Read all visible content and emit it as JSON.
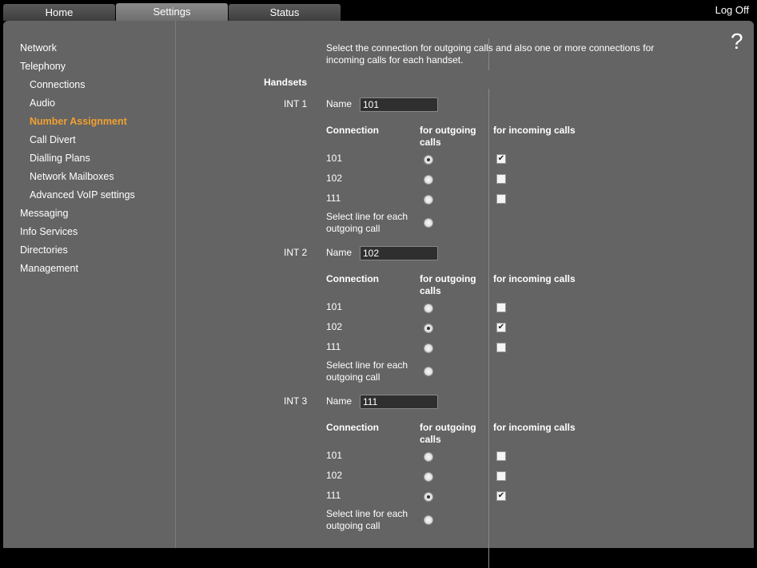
{
  "tabs": [
    {
      "label": "Home",
      "active": false
    },
    {
      "label": "Settings",
      "active": true
    },
    {
      "label": "Status",
      "active": false
    }
  ],
  "logoff": "Log Off",
  "help": "?",
  "nav": [
    {
      "label": "Network",
      "level": 0
    },
    {
      "label": "Telephony",
      "level": 0
    },
    {
      "label": "Connections",
      "level": 1
    },
    {
      "label": "Audio",
      "level": 1
    },
    {
      "label": "Number Assignment",
      "level": 1,
      "active": true
    },
    {
      "label": "Call Divert",
      "level": 1
    },
    {
      "label": "Dialling Plans",
      "level": 1
    },
    {
      "label": "Network Mailboxes",
      "level": 1
    },
    {
      "label": "Advanced VoIP settings",
      "level": 1
    },
    {
      "label": "Messaging",
      "level": 0
    },
    {
      "label": "Info Services",
      "level": 0
    },
    {
      "label": "Directories",
      "level": 0
    },
    {
      "label": "Management",
      "level": 0
    }
  ],
  "description": "Select the connection for outgoing calls and also one or more connections for incoming calls for each handset.",
  "handsets_label": "Handsets",
  "labels": {
    "name": "Name",
    "connection": "Connection",
    "outgoing": "for outgoing calls",
    "incoming": "for incoming calls",
    "select_line": "Select line for each outgoing call"
  },
  "handsets": [
    {
      "int": "INT 1",
      "name": "101",
      "rows": [
        {
          "conn": "101",
          "outgoing": true,
          "incoming": true
        },
        {
          "conn": "102",
          "outgoing": false,
          "incoming": false
        },
        {
          "conn": "111",
          "outgoing": false,
          "incoming": false
        }
      ],
      "select_line": false
    },
    {
      "int": "INT 2",
      "name": "102",
      "rows": [
        {
          "conn": "101",
          "outgoing": false,
          "incoming": false
        },
        {
          "conn": "102",
          "outgoing": true,
          "incoming": true
        },
        {
          "conn": "111",
          "outgoing": false,
          "incoming": false
        }
      ],
      "select_line": false
    },
    {
      "int": "INT 3",
      "name": "111",
      "rows": [
        {
          "conn": "101",
          "outgoing": false,
          "incoming": false
        },
        {
          "conn": "102",
          "outgoing": false,
          "incoming": false
        },
        {
          "conn": "111",
          "outgoing": true,
          "incoming": true
        }
      ],
      "select_line": false
    }
  ]
}
